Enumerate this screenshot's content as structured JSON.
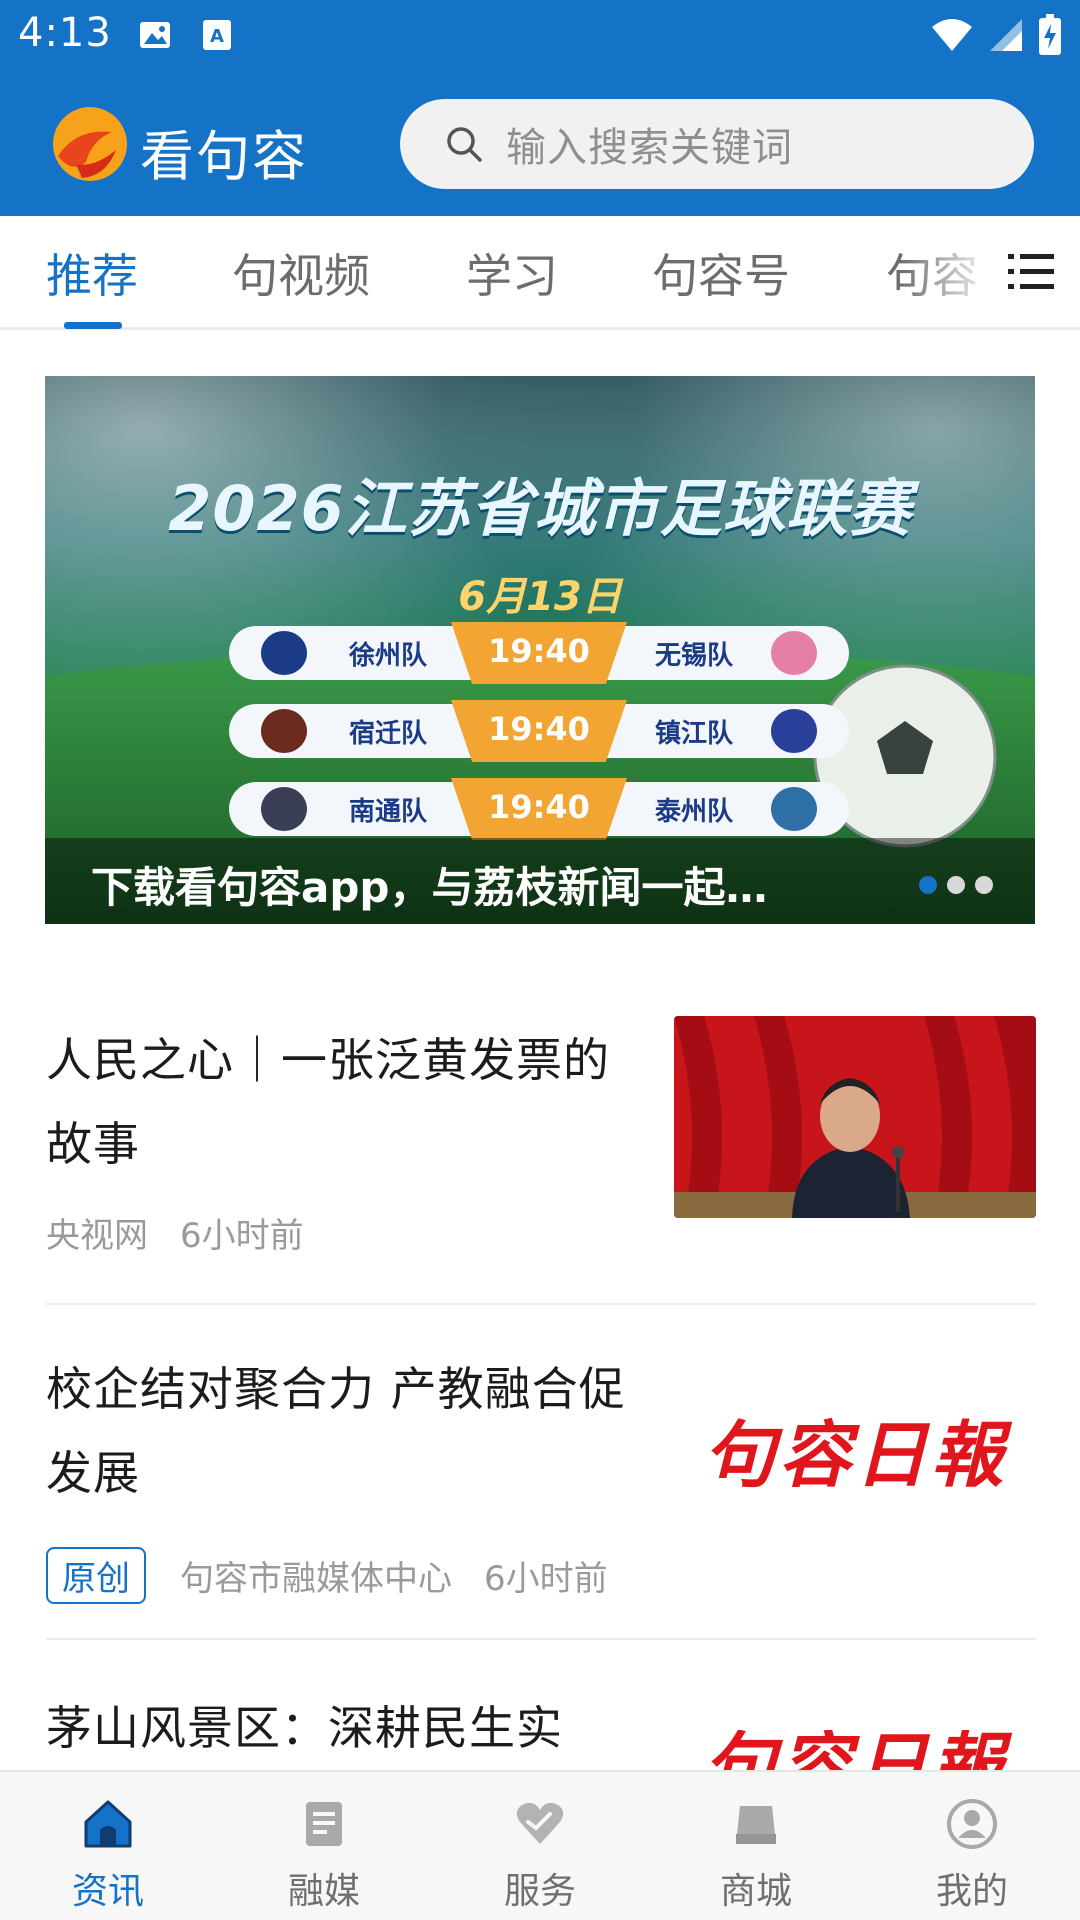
{
  "status_bar": {
    "time": "4:13",
    "icons_left": [
      "image-icon",
      "text-notification-icon"
    ],
    "icons_right": [
      "wifi-icon",
      "signal-icon",
      "battery-charging-icon"
    ]
  },
  "app_bar": {
    "app_name": "看句容",
    "search_placeholder": "输入搜索关键词",
    "background_color": "#1473c7"
  },
  "tabs": {
    "items": [
      {
        "label": "推荐",
        "active": true
      },
      {
        "label": "句视频",
        "active": false
      },
      {
        "label": "学习",
        "active": false
      },
      {
        "label": "句容号",
        "active": false
      },
      {
        "label": "句容",
        "active": false
      }
    ],
    "accent_color": "#1572c9",
    "menu_icon": "list-menu-icon"
  },
  "banner": {
    "title": "2026江苏省城市足球联赛",
    "date": "6月13日",
    "matches": [
      {
        "home": "徐州队",
        "time": "19:40",
        "away": "无锡队"
      },
      {
        "home": "宿迁队",
        "time": "19:40",
        "away": "镇江队"
      },
      {
        "home": "南通队",
        "time": "19:40",
        "away": "泰州队"
      }
    ],
    "caption": "下载看句容app，与荔枝新闻一起…",
    "slide_count": 3,
    "active_slide": 1
  },
  "news": [
    {
      "title": "人民之心｜一张泛黄发票的故事",
      "source": "央视网",
      "time": "6小时前",
      "tag": "",
      "thumbnail": "photo-speaker-red-curtain"
    },
    {
      "title": "校企结对聚合力 产教融合促发展",
      "source": "句容市融媒体中心",
      "time": "6小时前",
      "tag": "原创",
      "thumbnail_text": "句容日報"
    },
    {
      "title": "茅山风景区：深耕民生实",
      "thumbnail_text": "句容日報"
    }
  ],
  "bottom_nav": [
    {
      "label": "资讯",
      "icon": "home-icon",
      "active": true
    },
    {
      "label": "融媒",
      "icon": "document-icon",
      "active": false
    },
    {
      "label": "服务",
      "icon": "heart-icon",
      "active": false
    },
    {
      "label": "商城",
      "icon": "shopping-bag-icon",
      "active": false
    },
    {
      "label": "我的",
      "icon": "user-icon",
      "active": false
    }
  ]
}
